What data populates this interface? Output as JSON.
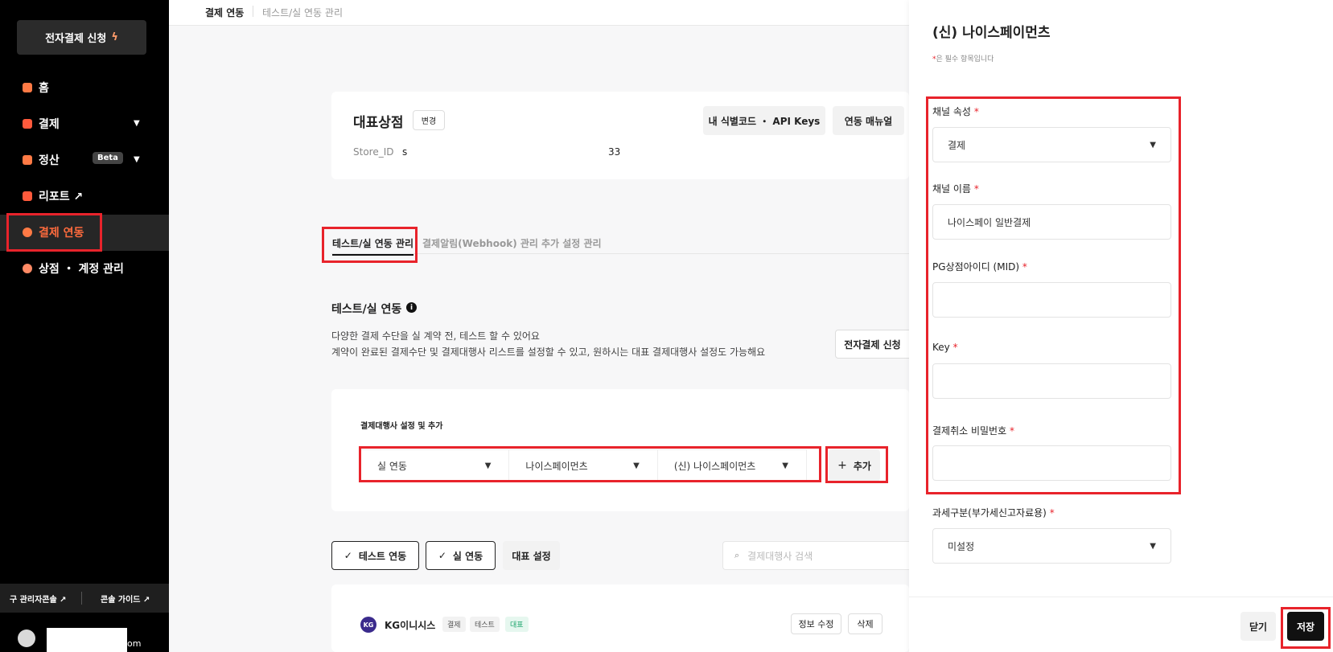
{
  "sidebar": {
    "apply_button": "전자결제 신청",
    "apply_icon": "lightning-icon",
    "items": [
      {
        "label": "홈",
        "icon": "home-icon",
        "color": "#ff7a45"
      },
      {
        "label": "결제",
        "icon": "layers-icon",
        "color": "#ff5a3c"
      },
      {
        "label": "정산",
        "icon": "document-icon",
        "color": "#ff7a45",
        "badge": "Beta"
      },
      {
        "label": "리포트 ↗",
        "icon": "chart-icon",
        "color": "#ff5a3c"
      },
      {
        "label": "결제 연동",
        "icon": "link-icon",
        "color": "#ff7a45"
      },
      {
        "label": "상점 ・ 계정 관리",
        "icon": "store-icon",
        "color": "#ff8a65"
      }
    ],
    "footer": {
      "old_console": "구 관리자콘솔 ↗",
      "guide": "콘솔 가이드 ↗"
    },
    "user_suffix": "om"
  },
  "breadcrumb": {
    "current": "결제 연동",
    "sub": "테스트/실 연동 관리"
  },
  "store": {
    "title": "대표상점",
    "change": "변경",
    "id_label": "Store_ID",
    "id_value": "s",
    "id_tail": "33",
    "keys_button": "내 식별코드 ・ API Keys",
    "manual_button": "연동 매뉴얼"
  },
  "tabs": [
    "테스트/실 연동 관리",
    "결제알림(Webhook) 관리",
    "추가 설정 관리"
  ],
  "section": {
    "title": "테스트/실 연동",
    "desc1": "다양한 결제 수단을 실 계약 전, 테스트 할 수 있어요",
    "desc2": "계약이 완료된 결제수단 및 결제대행사 리스트를 설정할 수 있고, 원하시는 대표 결제대행사 설정도 가능해요",
    "apply_button": "전자결제 신청"
  },
  "pg_setting": {
    "label": "결제대행사 설정 및 추가",
    "selects": [
      "실 연동",
      "나이스페이먼츠",
      "(신) 나이스페이먼츠"
    ],
    "add_button": "추가"
  },
  "filters": {
    "test": "테스트 연동",
    "live": "실 연동",
    "default": "대표 설정",
    "search_placeholder": "결제대행사 검색"
  },
  "pg_row": {
    "logo": "KG",
    "name": "KG이니시스",
    "tags": [
      "결제",
      "테스트",
      "대표"
    ],
    "edit": "정보 수정",
    "delete": "삭제"
  },
  "drawer": {
    "title": "(신) 나이스페이먼츠",
    "required_note": "은 필수 항목입니다",
    "fields": {
      "channel_type": {
        "label": "채널 속성",
        "value": "결제"
      },
      "channel_name": {
        "label": "채널 이름",
        "value": "나이스페이 일반결제"
      },
      "mid": {
        "label": "PG상점아이디 (MID)",
        "value": ""
      },
      "key": {
        "label": "Key",
        "value": ""
      },
      "cancel_pw": {
        "label": "결제취소 비밀번호",
        "value": ""
      },
      "tax": {
        "label": "과세구분(부가세신고자료용)",
        "value": "미설정"
      }
    },
    "close_button": "닫기",
    "save_button": "저장"
  },
  "colors": {
    "accent": "#ff6b3d",
    "annotation": "#e8232b",
    "primary_dark": "#111111"
  }
}
